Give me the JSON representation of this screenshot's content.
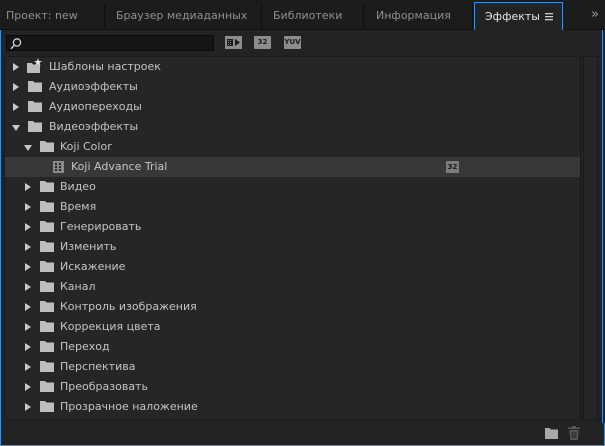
{
  "tabs": [
    {
      "label": "Проект: new",
      "active": false
    },
    {
      "label": "Браузер медиаданных",
      "active": false
    },
    {
      "label": "Библиотеки",
      "active": false
    },
    {
      "label": "Информация",
      "active": false
    },
    {
      "label": "Эффекты",
      "active": true
    }
  ],
  "tab_menu_icon": "hamburger-menu-icon",
  "overflow_icon": "double-chevron-right-icon",
  "overflow_glyph": "»",
  "toolbar": {
    "search_value": "",
    "search_placeholder": "",
    "buttons": [
      {
        "name": "accelerated-effects-filter",
        "label": "▦▶"
      },
      {
        "name": "32bit-effects-filter",
        "label": "32"
      },
      {
        "name": "yuv-effects-filter",
        "label": "YUV"
      }
    ]
  },
  "tree": {
    "rows": [
      {
        "label": "Шаблоны настроек",
        "state": "closed",
        "icon": "preset-folder-icon"
      },
      {
        "label": "Аудиоэффекты",
        "state": "closed",
        "icon": "folder-icon"
      },
      {
        "label": "Аудиопереходы",
        "state": "closed",
        "icon": "folder-icon"
      },
      {
        "label": "Видеоэффекты",
        "state": "open",
        "icon": "folder-icon"
      },
      {
        "label": "Koji Color",
        "state": "open",
        "icon": "folder-icon"
      },
      {
        "label": "Koji Advance Trial",
        "state": "leaf",
        "icon": "effect-icon",
        "badge": "32",
        "selected": true
      },
      {
        "label": "Видео",
        "state": "closed",
        "icon": "folder-icon"
      },
      {
        "label": "Время",
        "state": "closed",
        "icon": "folder-icon"
      },
      {
        "label": "Генерировать",
        "state": "closed",
        "icon": "folder-icon"
      },
      {
        "label": "Изменить",
        "state": "closed",
        "icon": "folder-icon"
      },
      {
        "label": "Искажение",
        "state": "closed",
        "icon": "folder-icon"
      },
      {
        "label": "Канал",
        "state": "closed",
        "icon": "folder-icon"
      },
      {
        "label": "Контроль изображения",
        "state": "closed",
        "icon": "folder-icon"
      },
      {
        "label": "Коррекция цвета",
        "state": "closed",
        "icon": "folder-icon"
      },
      {
        "label": "Переход",
        "state": "closed",
        "icon": "folder-icon"
      },
      {
        "label": "Перспектива",
        "state": "closed",
        "icon": "folder-icon"
      },
      {
        "label": "Преобразовать",
        "state": "closed",
        "icon": "folder-icon"
      },
      {
        "label": "Прозрачное наложение",
        "state": "closed",
        "icon": "folder-icon"
      }
    ]
  },
  "bottom": {
    "new_bin_icon": "new-bin-icon",
    "delete_icon": "trash-icon"
  },
  "colors": {
    "accent": "#3d8fd9",
    "panel_bg": "#232323",
    "text": "#c4c4c4"
  }
}
